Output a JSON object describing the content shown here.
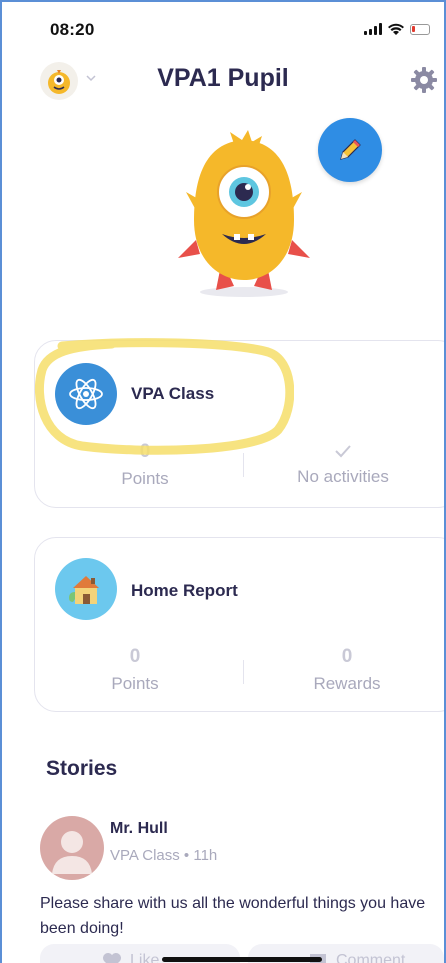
{
  "status": {
    "time": "08:20"
  },
  "header": {
    "title": "VPA1 Pupil"
  },
  "icons": {
    "avatar": "monster-avatar-icon",
    "chevron": "chevron-down-icon",
    "settings": "gear-icon",
    "edit": "pencil-icon",
    "class": "atom-icon",
    "home": "house-icon",
    "like": "heart-icon",
    "comment": "comment-icon"
  },
  "colors": {
    "accent_blue": "#2f8de4",
    "highlight": "#f6de6a",
    "text_dark": "#2c2a50",
    "text_muted": "#a9a9bc"
  },
  "class_card": {
    "title": "VPA Class",
    "points_value": "0",
    "points_label": "Points",
    "activities_label": "No activities"
  },
  "home_card": {
    "title": "Home Report",
    "points_value": "0",
    "points_label": "Points",
    "rewards_value": "0",
    "rewards_label": "Rewards"
  },
  "stories": {
    "heading": "Stories",
    "teacher": "Mr. Hull",
    "meta": "VPA Class • 11h",
    "text": "Please share with us all the wonderful things you have been doing!",
    "like_label": "Like",
    "comment_label": "Comment"
  }
}
